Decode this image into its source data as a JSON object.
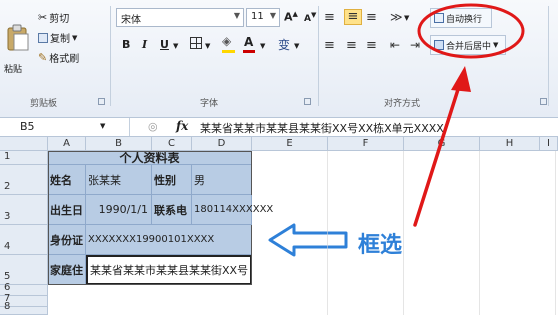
{
  "ribbon": {
    "clipboard": {
      "paste": "粘贴",
      "cut": "剪切",
      "copy": "复制",
      "format_painter": "格式刷",
      "group_label": "剪贴板"
    },
    "font": {
      "name": "宋体",
      "size": "11",
      "bold": "B",
      "italic": "I",
      "underline": "U",
      "group_label": "字体"
    },
    "alignment": {
      "wrap_text": "自动换行",
      "merge_center": "合并后居中",
      "group_label": "对齐方式"
    },
    "colors": {
      "annotation_red": "#e01818",
      "font_color_red": "#cc0000",
      "fill_yellow": "#ffd700"
    }
  },
  "formula_bar": {
    "name_box": "B5",
    "fx": "fx",
    "content": "某某省某某市某某县某某街XX号XX栋X单元XXXX"
  },
  "grid": {
    "columns": [
      "A",
      "B",
      "C",
      "D",
      "E",
      "F",
      "G",
      "H",
      "I"
    ],
    "rows": [
      "1",
      "2",
      "3",
      "4",
      "5",
      "6",
      "7",
      "8"
    ],
    "title": "个人资料表",
    "cells": {
      "a2": "姓名",
      "b2": "张某某",
      "c2": "性别",
      "d2": "男",
      "a3": "出生日",
      "b3": "1990/1/1",
      "c3": "联系电",
      "d3": "180114XXXXXX",
      "a4": "身份证",
      "b4": "XXXXXXX19900101XXXX",
      "a5": "家庭住",
      "b5": "某某省某某市某某县某某街XX号"
    }
  },
  "annotation": {
    "label": "框选"
  }
}
